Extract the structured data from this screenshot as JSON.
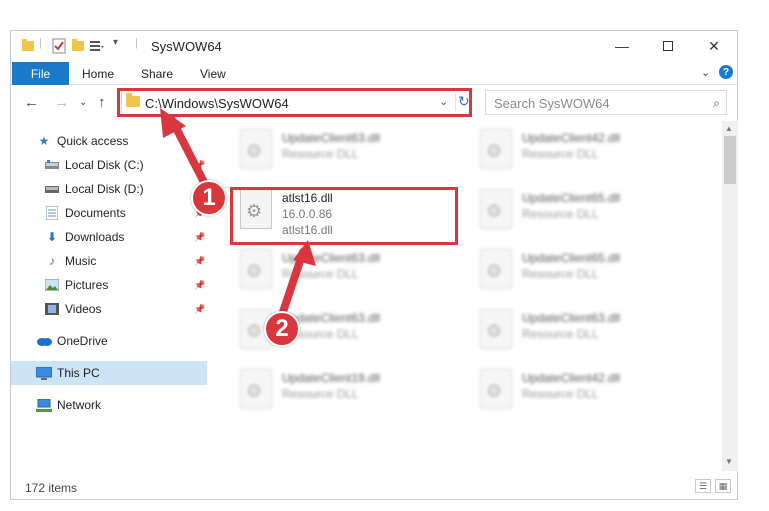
{
  "window": {
    "title": "SysWOW64",
    "minimize_icon": "minimize-icon",
    "maximize_icon": "maximize-icon",
    "close_icon": "close-icon"
  },
  "ribbon": {
    "tabs": [
      "File",
      "Home",
      "Share",
      "View"
    ],
    "help_label": "?"
  },
  "address_bar": {
    "path": "C:\\Windows\\SysWOW64",
    "search_placeholder": "Search SysWOW64"
  },
  "nav_pane": {
    "items": [
      {
        "label": "Quick access",
        "icon": "star-icon"
      },
      {
        "label": "Local Disk (C:)",
        "icon": "drive-icon"
      },
      {
        "label": "Local Disk (D:)",
        "icon": "drive-icon"
      },
      {
        "label": "Documents",
        "icon": "documents-icon"
      },
      {
        "label": "Downloads",
        "icon": "download-icon"
      },
      {
        "label": "Music",
        "icon": "music-icon"
      },
      {
        "label": "Pictures",
        "icon": "pictures-icon"
      },
      {
        "label": "Videos",
        "icon": "videos-icon"
      },
      {
        "label": "OneDrive",
        "icon": "cloud-icon"
      },
      {
        "label": "This PC",
        "icon": "computer-icon"
      },
      {
        "label": "Network",
        "icon": "network-icon"
      }
    ]
  },
  "files": {
    "highlighted": {
      "name": "atlst16.dll",
      "version": "16.0.0.86",
      "description": "atlst16.dll"
    },
    "blurred": [
      {
        "name": "UpdateClient63.dll",
        "type": "Resource DLL"
      },
      {
        "name": "UpdateClient42.dll",
        "type": "Resource DLL"
      },
      {
        "name": "UpdateClient65.dll",
        "type": "Resource DLL"
      },
      {
        "name": "UpdateClient63.dll",
        "type": "Resource DLL"
      },
      {
        "name": "UpdateClient65.dll",
        "type": "Resource DLL"
      },
      {
        "name": "UpdateClient63.dll",
        "type": "Resource DLL"
      },
      {
        "name": "UpdateClient63.dll",
        "type": "Resource DLL"
      },
      {
        "name": "UpdateClient19.dll",
        "type": "Resource DLL"
      },
      {
        "name": "UpdateClient42.dll",
        "type": "Resource DLL"
      }
    ]
  },
  "status_bar": {
    "item_count": "172 items"
  },
  "annotations": {
    "step1": "1",
    "step2": "2",
    "accent_color": "#d9363e"
  },
  "colors": {
    "file_tab": "#1979ca",
    "selection": "#cce4f7"
  }
}
